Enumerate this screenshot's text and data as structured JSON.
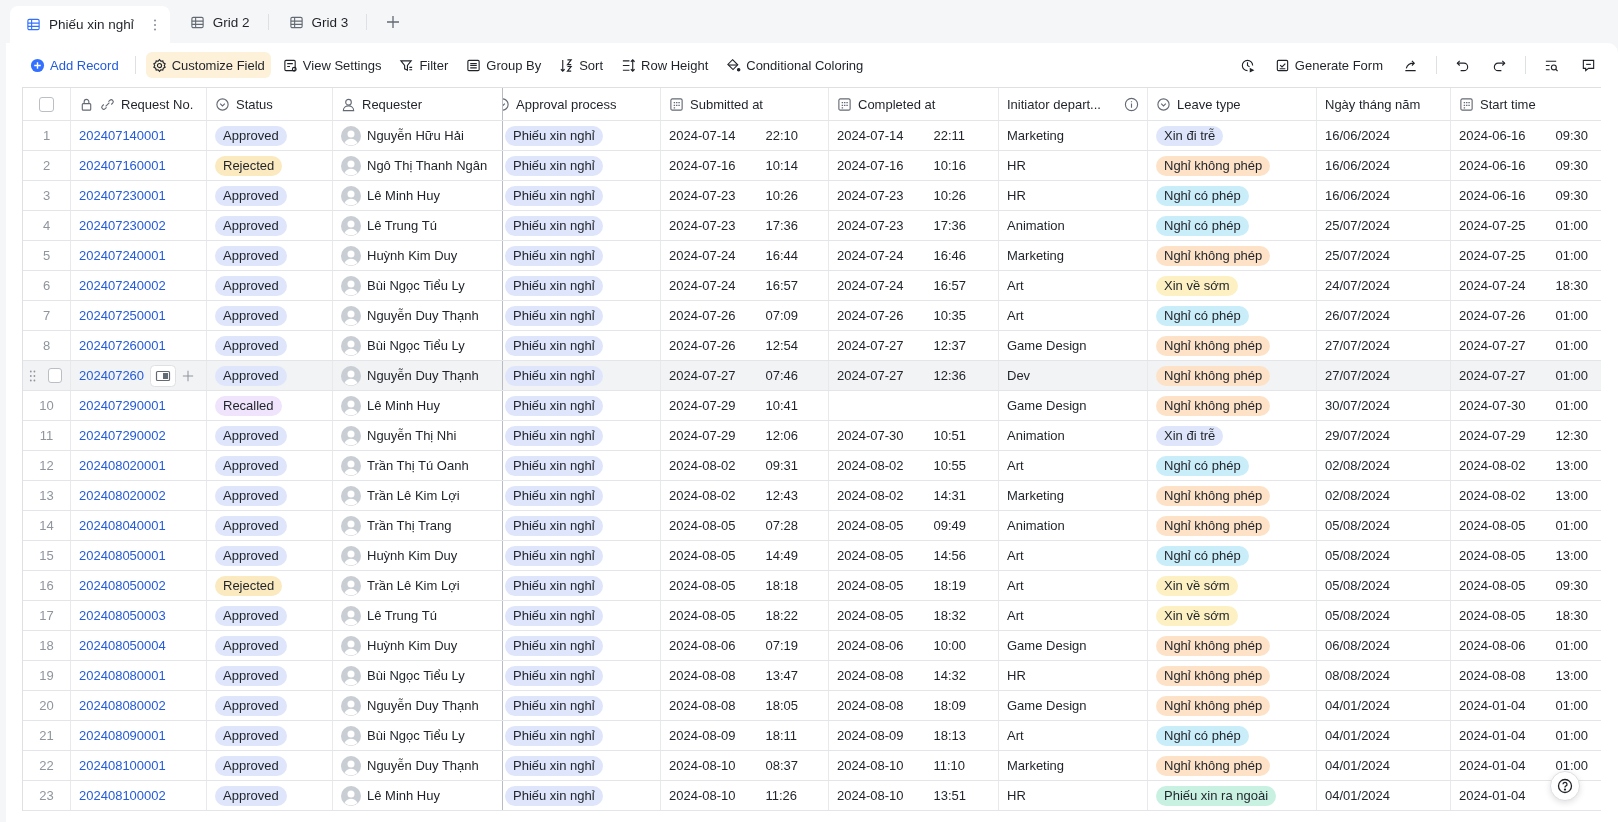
{
  "tabs": [
    {
      "label": "Phiếu xin nghỉ",
      "selected": true
    },
    {
      "label": "Grid 2",
      "selected": false
    },
    {
      "label": "Grid 3",
      "selected": false
    }
  ],
  "toolbar": {
    "add_record": "Add Record",
    "items": [
      {
        "kind": "gear",
        "label": "Customize Field",
        "selected": true
      },
      {
        "kind": "view",
        "label": "View Settings",
        "selected": false
      },
      {
        "kind": "filter",
        "label": "Filter",
        "selected": false
      },
      {
        "kind": "group",
        "label": "Group By",
        "selected": false
      },
      {
        "kind": "sort",
        "label": "Sort",
        "selected": false
      },
      {
        "kind": "height",
        "label": "Row Height",
        "selected": false
      },
      {
        "kind": "paint",
        "label": "Conditional Coloring",
        "selected": false
      }
    ],
    "generate_form": "Generate Form"
  },
  "table": {
    "select_all_checked": false,
    "columns": [
      {
        "label": "Request No."
      },
      {
        "label": "Status"
      },
      {
        "label": "Requester"
      },
      {
        "label": "Approval process"
      },
      {
        "label": "Submitted at"
      },
      {
        "label": "Completed at"
      },
      {
        "label": "Initiator depart..."
      },
      {
        "label": "Leave type"
      },
      {
        "label": "Ngày tháng năm"
      },
      {
        "label": "Start time"
      }
    ],
    "rows": [
      {
        "checked": false,
        "index": "1",
        "id": "202407140001",
        "status": {
          "label": "Approved",
          "color": "#dfe6fb"
        },
        "requester": "Nguyễn Hữu Hải",
        "process": "Phiếu xin nghỉ",
        "submitted": [
          "2024-07-14",
          "22:10"
        ],
        "completed": [
          "2024-07-14",
          "22:11"
        ],
        "department": "Marketing",
        "leave": {
          "label": "Xin đi trễ",
          "color": "#dfe6fb"
        },
        "date": "16/06/2024",
        "start": [
          "2024-06-16",
          "09:30"
        ],
        "hovered": false
      },
      {
        "checked": false,
        "index": "2",
        "id": "202407160001",
        "status": {
          "label": "Rejected",
          "color": "#fbeac0"
        },
        "requester": "Ngô Thị Thanh Ngân",
        "process": "Phiếu xin nghỉ",
        "submitted": [
          "2024-07-16",
          "10:14"
        ],
        "completed": [
          "2024-07-16",
          "10:16"
        ],
        "department": "HR",
        "leave": {
          "label": "Nghỉ không phép",
          "color": "#fde2c8"
        },
        "date": "16/06/2024",
        "start": [
          "2024-06-16",
          "09:30"
        ],
        "hovered": false
      },
      {
        "checked": false,
        "index": "3",
        "id": "202407230001",
        "status": {
          "label": "Approved",
          "color": "#dfe6fb"
        },
        "requester": "Lê Minh Huy",
        "process": "Phiếu xin nghỉ",
        "submitted": [
          "2024-07-23",
          "10:26"
        ],
        "completed": [
          "2024-07-23",
          "10:26"
        ],
        "department": "HR",
        "leave": {
          "label": "Nghỉ có phép",
          "color": "#caedfa"
        },
        "date": "16/06/2024",
        "start": [
          "2024-06-16",
          "09:30"
        ],
        "hovered": false
      },
      {
        "checked": false,
        "index": "4",
        "id": "202407230002",
        "status": {
          "label": "Approved",
          "color": "#dfe6fb"
        },
        "requester": "Lê Trung Tú",
        "process": "Phiếu xin nghỉ",
        "submitted": [
          "2024-07-23",
          "17:36"
        ],
        "completed": [
          "2024-07-23",
          "17:36"
        ],
        "department": "Animation",
        "leave": {
          "label": "Nghỉ có phép",
          "color": "#caedfa"
        },
        "date": "25/07/2024",
        "start": [
          "2024-07-25",
          "01:00"
        ],
        "hovered": false
      },
      {
        "checked": false,
        "index": "5",
        "id": "202407240001",
        "status": {
          "label": "Approved",
          "color": "#dfe6fb"
        },
        "requester": "Huỳnh Kim Duy",
        "process": "Phiếu xin nghỉ",
        "submitted": [
          "2024-07-24",
          "16:44"
        ],
        "completed": [
          "2024-07-24",
          "16:46"
        ],
        "department": "Marketing",
        "leave": {
          "label": "Nghỉ không phép",
          "color": "#fde2c8"
        },
        "date": "25/07/2024",
        "start": [
          "2024-07-25",
          "01:00"
        ],
        "hovered": false
      },
      {
        "checked": false,
        "index": "6",
        "id": "202407240002",
        "status": {
          "label": "Approved",
          "color": "#dfe6fb"
        },
        "requester": "Bùi Ngọc Tiểu Ly",
        "process": "Phiếu xin nghỉ",
        "submitted": [
          "2024-07-24",
          "16:57"
        ],
        "completed": [
          "2024-07-24",
          "16:57"
        ],
        "department": "Art",
        "leave": {
          "label": "Xin về sớm",
          "color": "#fdf0c2"
        },
        "date": "24/07/2024",
        "start": [
          "2024-07-24",
          "18:30"
        ],
        "hovered": false
      },
      {
        "checked": false,
        "index": "7",
        "id": "202407250001",
        "status": {
          "label": "Approved",
          "color": "#dfe6fb"
        },
        "requester": "Nguyễn Duy Thạnh",
        "process": "Phiếu xin nghỉ",
        "submitted": [
          "2024-07-26",
          "07:09"
        ],
        "completed": [
          "2024-07-26",
          "10:35"
        ],
        "department": "Art",
        "leave": {
          "label": "Nghỉ có phép",
          "color": "#caedfa"
        },
        "date": "26/07/2024",
        "start": [
          "2024-07-26",
          "01:00"
        ],
        "hovered": false
      },
      {
        "checked": false,
        "index": "8",
        "id": "202407260001",
        "status": {
          "label": "Approved",
          "color": "#dfe6fb"
        },
        "requester": "Bùi Ngọc Tiểu Ly",
        "process": "Phiếu xin nghỉ",
        "submitted": [
          "2024-07-26",
          "12:54"
        ],
        "completed": [
          "2024-07-27",
          "12:37"
        ],
        "department": "Game Design",
        "leave": {
          "label": "Nghỉ không phép",
          "color": "#fde2c8"
        },
        "date": "27/07/2024",
        "start": [
          "2024-07-27",
          "01:00"
        ],
        "hovered": false
      },
      {
        "checked": false,
        "id": "202407260",
        "status": {
          "label": "Approved",
          "color": "#dfe6fb"
        },
        "requester": "Nguyễn Duy Thạnh",
        "process": "Phiếu xin nghỉ",
        "submitted": [
          "2024-07-27",
          "07:46"
        ],
        "completed": [
          "2024-07-27",
          "12:36"
        ],
        "department": "Dev",
        "leave": {
          "label": "Nghỉ không phép",
          "color": "#fde2c8"
        },
        "date": "27/07/2024",
        "start": [
          "2024-07-27",
          "01:00"
        ],
        "hovered": true
      },
      {
        "checked": false,
        "index": "10",
        "id": "202407290001",
        "status": {
          "label": "Recalled",
          "color": "#efe4fb"
        },
        "requester": "Lê Minh Huy",
        "process": "Phiếu xin nghỉ",
        "submitted": [
          "2024-07-29",
          "10:41"
        ],
        "completed": [],
        "department": "Game Design",
        "leave": {
          "label": "Nghỉ không phép",
          "color": "#fde2c8"
        },
        "date": "30/07/2024",
        "start": [
          "2024-07-30",
          "01:00"
        ],
        "hovered": false
      },
      {
        "checked": false,
        "index": "11",
        "id": "202407290002",
        "status": {
          "label": "Approved",
          "color": "#dfe6fb"
        },
        "requester": "Nguyễn Thị  Nhi",
        "process": "Phiếu xin nghỉ",
        "submitted": [
          "2024-07-29",
          "12:06"
        ],
        "completed": [
          "2024-07-30",
          "10:51"
        ],
        "department": "Animation",
        "leave": {
          "label": "Xin đi trễ",
          "color": "#dfe6fb"
        },
        "date": "29/07/2024",
        "start": [
          "2024-07-29",
          "12:30"
        ],
        "hovered": false
      },
      {
        "checked": false,
        "index": "12",
        "id": "202408020001",
        "status": {
          "label": "Approved",
          "color": "#dfe6fb"
        },
        "requester": "Trần Thị Tú Oanh",
        "process": "Phiếu xin nghỉ",
        "submitted": [
          "2024-08-02",
          "09:31"
        ],
        "completed": [
          "2024-08-02",
          "10:55"
        ],
        "department": "Art",
        "leave": {
          "label": "Nghỉ có phép",
          "color": "#caedfa"
        },
        "date": "02/08/2024",
        "start": [
          "2024-08-02",
          "13:00"
        ],
        "hovered": false
      },
      {
        "checked": false,
        "index": "13",
        "id": "202408020002",
        "status": {
          "label": "Approved",
          "color": "#dfe6fb"
        },
        "requester": "Trần Lê Kim Lợi",
        "process": "Phiếu xin nghỉ",
        "submitted": [
          "2024-08-02",
          "12:43"
        ],
        "completed": [
          "2024-08-02",
          "14:31"
        ],
        "department": "Marketing",
        "leave": {
          "label": "Nghỉ không phép",
          "color": "#fde2c8"
        },
        "date": "02/08/2024",
        "start": [
          "2024-08-02",
          "13:00"
        ],
        "hovered": false
      },
      {
        "checked": false,
        "index": "14",
        "id": "202408040001",
        "status": {
          "label": "Approved",
          "color": "#dfe6fb"
        },
        "requester": "Trần Thị Trang",
        "process": "Phiếu xin nghỉ",
        "submitted": [
          "2024-08-05",
          "07:28"
        ],
        "completed": [
          "2024-08-05",
          "09:49"
        ],
        "department": "Animation",
        "leave": {
          "label": "Nghỉ không phép",
          "color": "#fde2c8"
        },
        "date": "05/08/2024",
        "start": [
          "2024-08-05",
          "01:00"
        ],
        "hovered": false
      },
      {
        "checked": false,
        "index": "15",
        "id": "202408050001",
        "status": {
          "label": "Approved",
          "color": "#dfe6fb"
        },
        "requester": "Huỳnh Kim Duy",
        "process": "Phiếu xin nghỉ",
        "submitted": [
          "2024-08-05",
          "14:49"
        ],
        "completed": [
          "2024-08-05",
          "14:56"
        ],
        "department": "Art",
        "leave": {
          "label": "Nghỉ có phép",
          "color": "#caedfa"
        },
        "date": "05/08/2024",
        "start": [
          "2024-08-05",
          "13:00"
        ],
        "hovered": false
      },
      {
        "checked": false,
        "index": "16",
        "id": "202408050002",
        "status": {
          "label": "Rejected",
          "color": "#fbeac0"
        },
        "requester": "Trần Lê Kim Lợi",
        "process": "Phiếu xin nghỉ",
        "submitted": [
          "2024-08-05",
          "18:18"
        ],
        "completed": [
          "2024-08-05",
          "18:19"
        ],
        "department": "Art",
        "leave": {
          "label": "Xin về sớm",
          "color": "#fdf0c2"
        },
        "date": "05/08/2024",
        "start": [
          "2024-08-05",
          "09:30"
        ],
        "hovered": false
      },
      {
        "checked": false,
        "index": "17",
        "id": "202408050003",
        "status": {
          "label": "Approved",
          "color": "#dfe6fb"
        },
        "requester": "Lê Trung Tú",
        "process": "Phiếu xin nghỉ",
        "submitted": [
          "2024-08-05",
          "18:22"
        ],
        "completed": [
          "2024-08-05",
          "18:32"
        ],
        "department": "Art",
        "leave": {
          "label": "Xin về sớm",
          "color": "#fdf0c2"
        },
        "date": "05/08/2024",
        "start": [
          "2024-08-05",
          "18:30"
        ],
        "hovered": false
      },
      {
        "checked": false,
        "index": "18",
        "id": "202408050004",
        "status": {
          "label": "Approved",
          "color": "#dfe6fb"
        },
        "requester": "Huỳnh Kim Duy",
        "process": "Phiếu xin nghỉ",
        "submitted": [
          "2024-08-06",
          "07:19"
        ],
        "completed": [
          "2024-08-06",
          "10:00"
        ],
        "department": "Game Design",
        "leave": {
          "label": "Nghỉ không phép",
          "color": "#fde2c8"
        },
        "date": "06/08/2024",
        "start": [
          "2024-08-06",
          "01:00"
        ],
        "hovered": false
      },
      {
        "checked": false,
        "index": "19",
        "id": "202408080001",
        "status": {
          "label": "Approved",
          "color": "#dfe6fb"
        },
        "requester": "Bùi Ngọc Tiểu Ly",
        "process": "Phiếu xin nghỉ",
        "submitted": [
          "2024-08-08",
          "13:47"
        ],
        "completed": [
          "2024-08-08",
          "14:32"
        ],
        "department": "HR",
        "leave": {
          "label": "Nghỉ không phép",
          "color": "#fde2c8"
        },
        "date": "08/08/2024",
        "start": [
          "2024-08-08",
          "13:00"
        ],
        "hovered": false
      },
      {
        "checked": false,
        "index": "20",
        "id": "202408080002",
        "status": {
          "label": "Approved",
          "color": "#dfe6fb"
        },
        "requester": "Nguyễn Duy Thạnh",
        "process": "Phiếu xin nghỉ",
        "submitted": [
          "2024-08-08",
          "18:05"
        ],
        "completed": [
          "2024-08-08",
          "18:09"
        ],
        "department": "Game Design",
        "leave": {
          "label": "Nghỉ không phép",
          "color": "#fde2c8"
        },
        "date": "04/01/2024",
        "start": [
          "2024-01-04",
          "01:00"
        ],
        "hovered": false
      },
      {
        "checked": false,
        "index": "21",
        "id": "202408090001",
        "status": {
          "label": "Approved",
          "color": "#dfe6fb"
        },
        "requester": "Bùi Ngọc Tiểu Ly",
        "process": "Phiếu xin nghỉ",
        "submitted": [
          "2024-08-09",
          "18:11"
        ],
        "completed": [
          "2024-08-09",
          "18:13"
        ],
        "department": "Art",
        "leave": {
          "label": "Nghỉ có phép",
          "color": "#caedfa"
        },
        "date": "04/01/2024",
        "start": [
          "2024-01-04",
          "01:00"
        ],
        "hovered": false
      },
      {
        "checked": false,
        "index": "22",
        "id": "202408100001",
        "status": {
          "label": "Approved",
          "color": "#dfe6fb"
        },
        "requester": "Nguyễn Duy Thạnh",
        "process": "Phiếu xin nghỉ",
        "submitted": [
          "2024-08-10",
          "08:37"
        ],
        "completed": [
          "2024-08-10",
          "11:10"
        ],
        "department": "Marketing",
        "leave": {
          "label": "Nghỉ không phép",
          "color": "#fde2c8"
        },
        "date": "04/01/2024",
        "start": [
          "2024-01-04",
          "01:00"
        ],
        "hovered": false
      },
      {
        "checked": false,
        "index": "23",
        "id": "202408100002",
        "status": {
          "label": "Approved",
          "color": "#dfe6fb"
        },
        "requester": "Lê Minh Huy",
        "process": "Phiếu xin nghỉ",
        "submitted": [
          "2024-08-10",
          "11:26"
        ],
        "completed": [
          "2024-08-10",
          "13:51"
        ],
        "department": "HR",
        "leave": {
          "label": "Phiếu xin ra ngoài",
          "color": "#c8f1e2"
        },
        "date": "04/01/2024",
        "start": [
          "2024-01-04"
        ],
        "hovered": false
      }
    ]
  }
}
